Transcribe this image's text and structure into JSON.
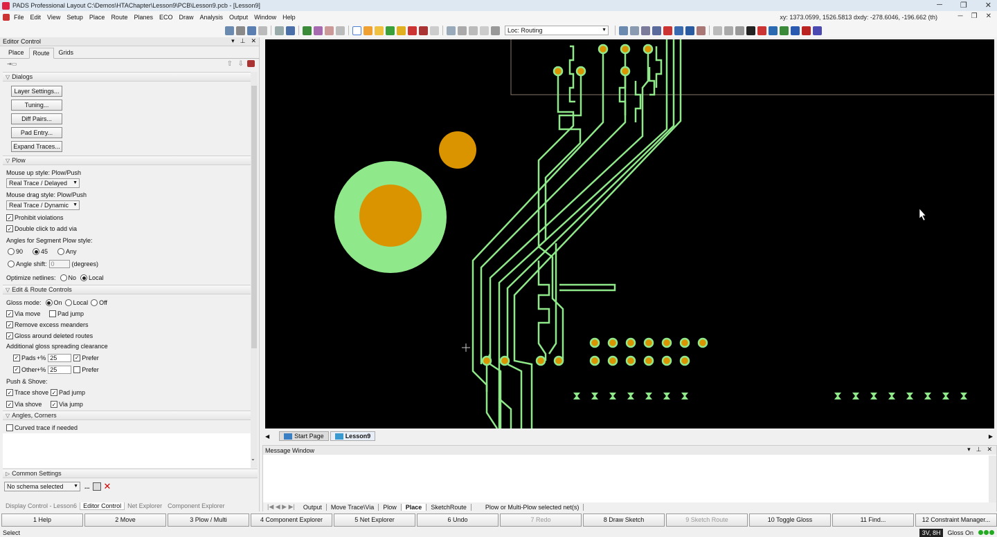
{
  "window": {
    "title": "PADS Professional Layout  C:\\Demos\\HTAChapter\\Lesson9\\PCB\\Lesson9.pcb - [Lesson9]"
  },
  "menu": [
    "File",
    "Edit",
    "View",
    "Setup",
    "Place",
    "Route",
    "Planes",
    "ECO",
    "Draw",
    "Analysis",
    "Output",
    "Window",
    "Help"
  ],
  "coords_readout": "xy: 1373.0599, 1526.5813  dxdy: -278.6046, -196.662  (th)",
  "toolbar": {
    "loc_label": "Loc: Routing"
  },
  "editor": {
    "title": "Editor Control",
    "tabs": [
      "Place",
      "Route",
      "Grids"
    ],
    "active_tab": "Route",
    "dialogs": {
      "header": "Dialogs",
      "buttons": [
        "Layer Settings...",
        "Tuning...",
        "Diff Pairs...",
        "Pad Entry...",
        "Expand Traces..."
      ]
    },
    "plow": {
      "header": "Plow",
      "mouse_up_label": "Mouse up style: Plow/Push",
      "mouse_up_value": "Real Trace / Delayed",
      "mouse_drag_label": "Mouse drag style: Plow/Push",
      "mouse_drag_value": "Real Trace / Dynamic",
      "prohibit": "Prohibit violations",
      "double_click": "Double click to add via",
      "angles_label": "Angles for Segment Plow style:",
      "angle_90": "90",
      "angle_45": "45",
      "angle_any": "Any",
      "angle_shift": "Angle shift:",
      "angle_shift_value": "0",
      "degrees": "(degrees)",
      "optimize": "Optimize netlines:",
      "opt_no": "No",
      "opt_local": "Local"
    },
    "edit_route": {
      "header": "Edit & Route Controls",
      "gloss_mode": "Gloss mode:",
      "gloss_on": "On",
      "gloss_local": "Local",
      "gloss_off": "Off",
      "via_move": "Via move",
      "pad_jump": "Pad jump",
      "remove_meanders": "Remove excess meanders",
      "gloss_deleted": "Gloss around deleted routes",
      "additional": "Additional gloss spreading clearance",
      "pads": "Pads",
      "pct": "+%",
      "pads_value": "25",
      "prefer": "Prefer",
      "other": "Other",
      "other_value": "25",
      "push_shove": "Push & Shove:",
      "trace_shove": "Trace shove",
      "pad_jump2": "Pad jump",
      "via_shove": "Via shove",
      "via_jump": "Via jump"
    },
    "angles": {
      "header": "Angles, Corners",
      "curved": "Curved trace if needed"
    },
    "common": {
      "header": "Common Settings",
      "schema": "No schema selected",
      "dots": "..."
    },
    "bottom_tabs": [
      "Display Control - Lesson6",
      "Editor Control",
      "Net Explorer",
      "Component Explorer"
    ]
  },
  "doc_tabs": [
    "Start Page",
    "Lesson9"
  ],
  "message_window": {
    "title": "Message Window",
    "tabs": [
      "Output",
      "Move Trace\\Via",
      "Plow",
      "Place",
      "SketchRoute",
      "Plow or Multi-Plow selected net(s)"
    ],
    "active_tab": "Place"
  },
  "fkeys": [
    {
      "label": "1 Help",
      "enabled": true
    },
    {
      "label": "2 Move",
      "enabled": true
    },
    {
      "label": "3 Plow / Multi",
      "enabled": true
    },
    {
      "label": "4 Component Explorer",
      "enabled": true
    },
    {
      "label": "5 Net Explorer",
      "enabled": true
    },
    {
      "label": "6 Undo",
      "enabled": true
    },
    {
      "label": "7 Redo",
      "enabled": false
    },
    {
      "label": "8 Draw Sketch",
      "enabled": true
    },
    {
      "label": "9 Sketch Route",
      "enabled": false
    },
    {
      "label": "10 Toggle Gloss",
      "enabled": true
    },
    {
      "label": "11 Find...",
      "enabled": true
    },
    {
      "label": "12 Constraint Manager...",
      "enabled": true
    }
  ],
  "status": {
    "left": "Select",
    "layer": "3V, 8H",
    "gloss": "Gloss On"
  },
  "colors": {
    "trace": "#8fe88a",
    "pad": "#d99400",
    "canvas": "#000000"
  }
}
